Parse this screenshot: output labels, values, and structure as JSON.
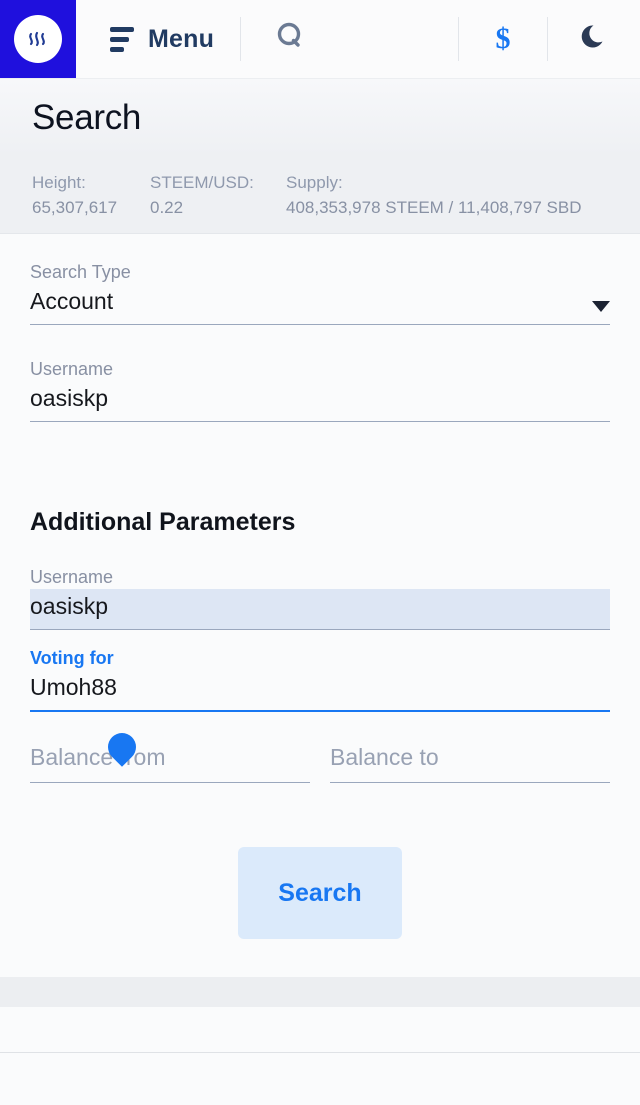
{
  "navbar": {
    "logo_icon": "steem-logo-icon",
    "menu_label": "Menu",
    "menu_icon": "hamburger-icon",
    "search_icon": "search-icon",
    "dollar_icon": "dollar-icon",
    "dollar_glyph": "$",
    "moon_icon": "moon-icon",
    "accent_color": "#1877f2",
    "logo_bg": "#1f10dd"
  },
  "page": {
    "title": "Search"
  },
  "stats": {
    "height_label": "Height:",
    "height_value": "65,307,617",
    "price_label": "STEEM/USD:",
    "price_value": "0.22",
    "supply_label": "Supply:",
    "supply_value": "408,353,978 STEEM / 11,408,797 SBD"
  },
  "form": {
    "search_type": {
      "label": "Search Type",
      "value": "Account",
      "options": [
        "Account"
      ]
    },
    "username": {
      "label": "Username",
      "value": "oasiskp"
    }
  },
  "additional": {
    "heading": "Additional Parameters",
    "username": {
      "label": "Username",
      "value": "oasiskp"
    },
    "voting_for": {
      "label": "Voting for",
      "value": "Umoh88"
    },
    "balance_from": {
      "placeholder": "Balance from",
      "value": ""
    },
    "balance_to": {
      "placeholder": "Balance to",
      "value": ""
    }
  },
  "actions": {
    "search_label": "Search"
  }
}
